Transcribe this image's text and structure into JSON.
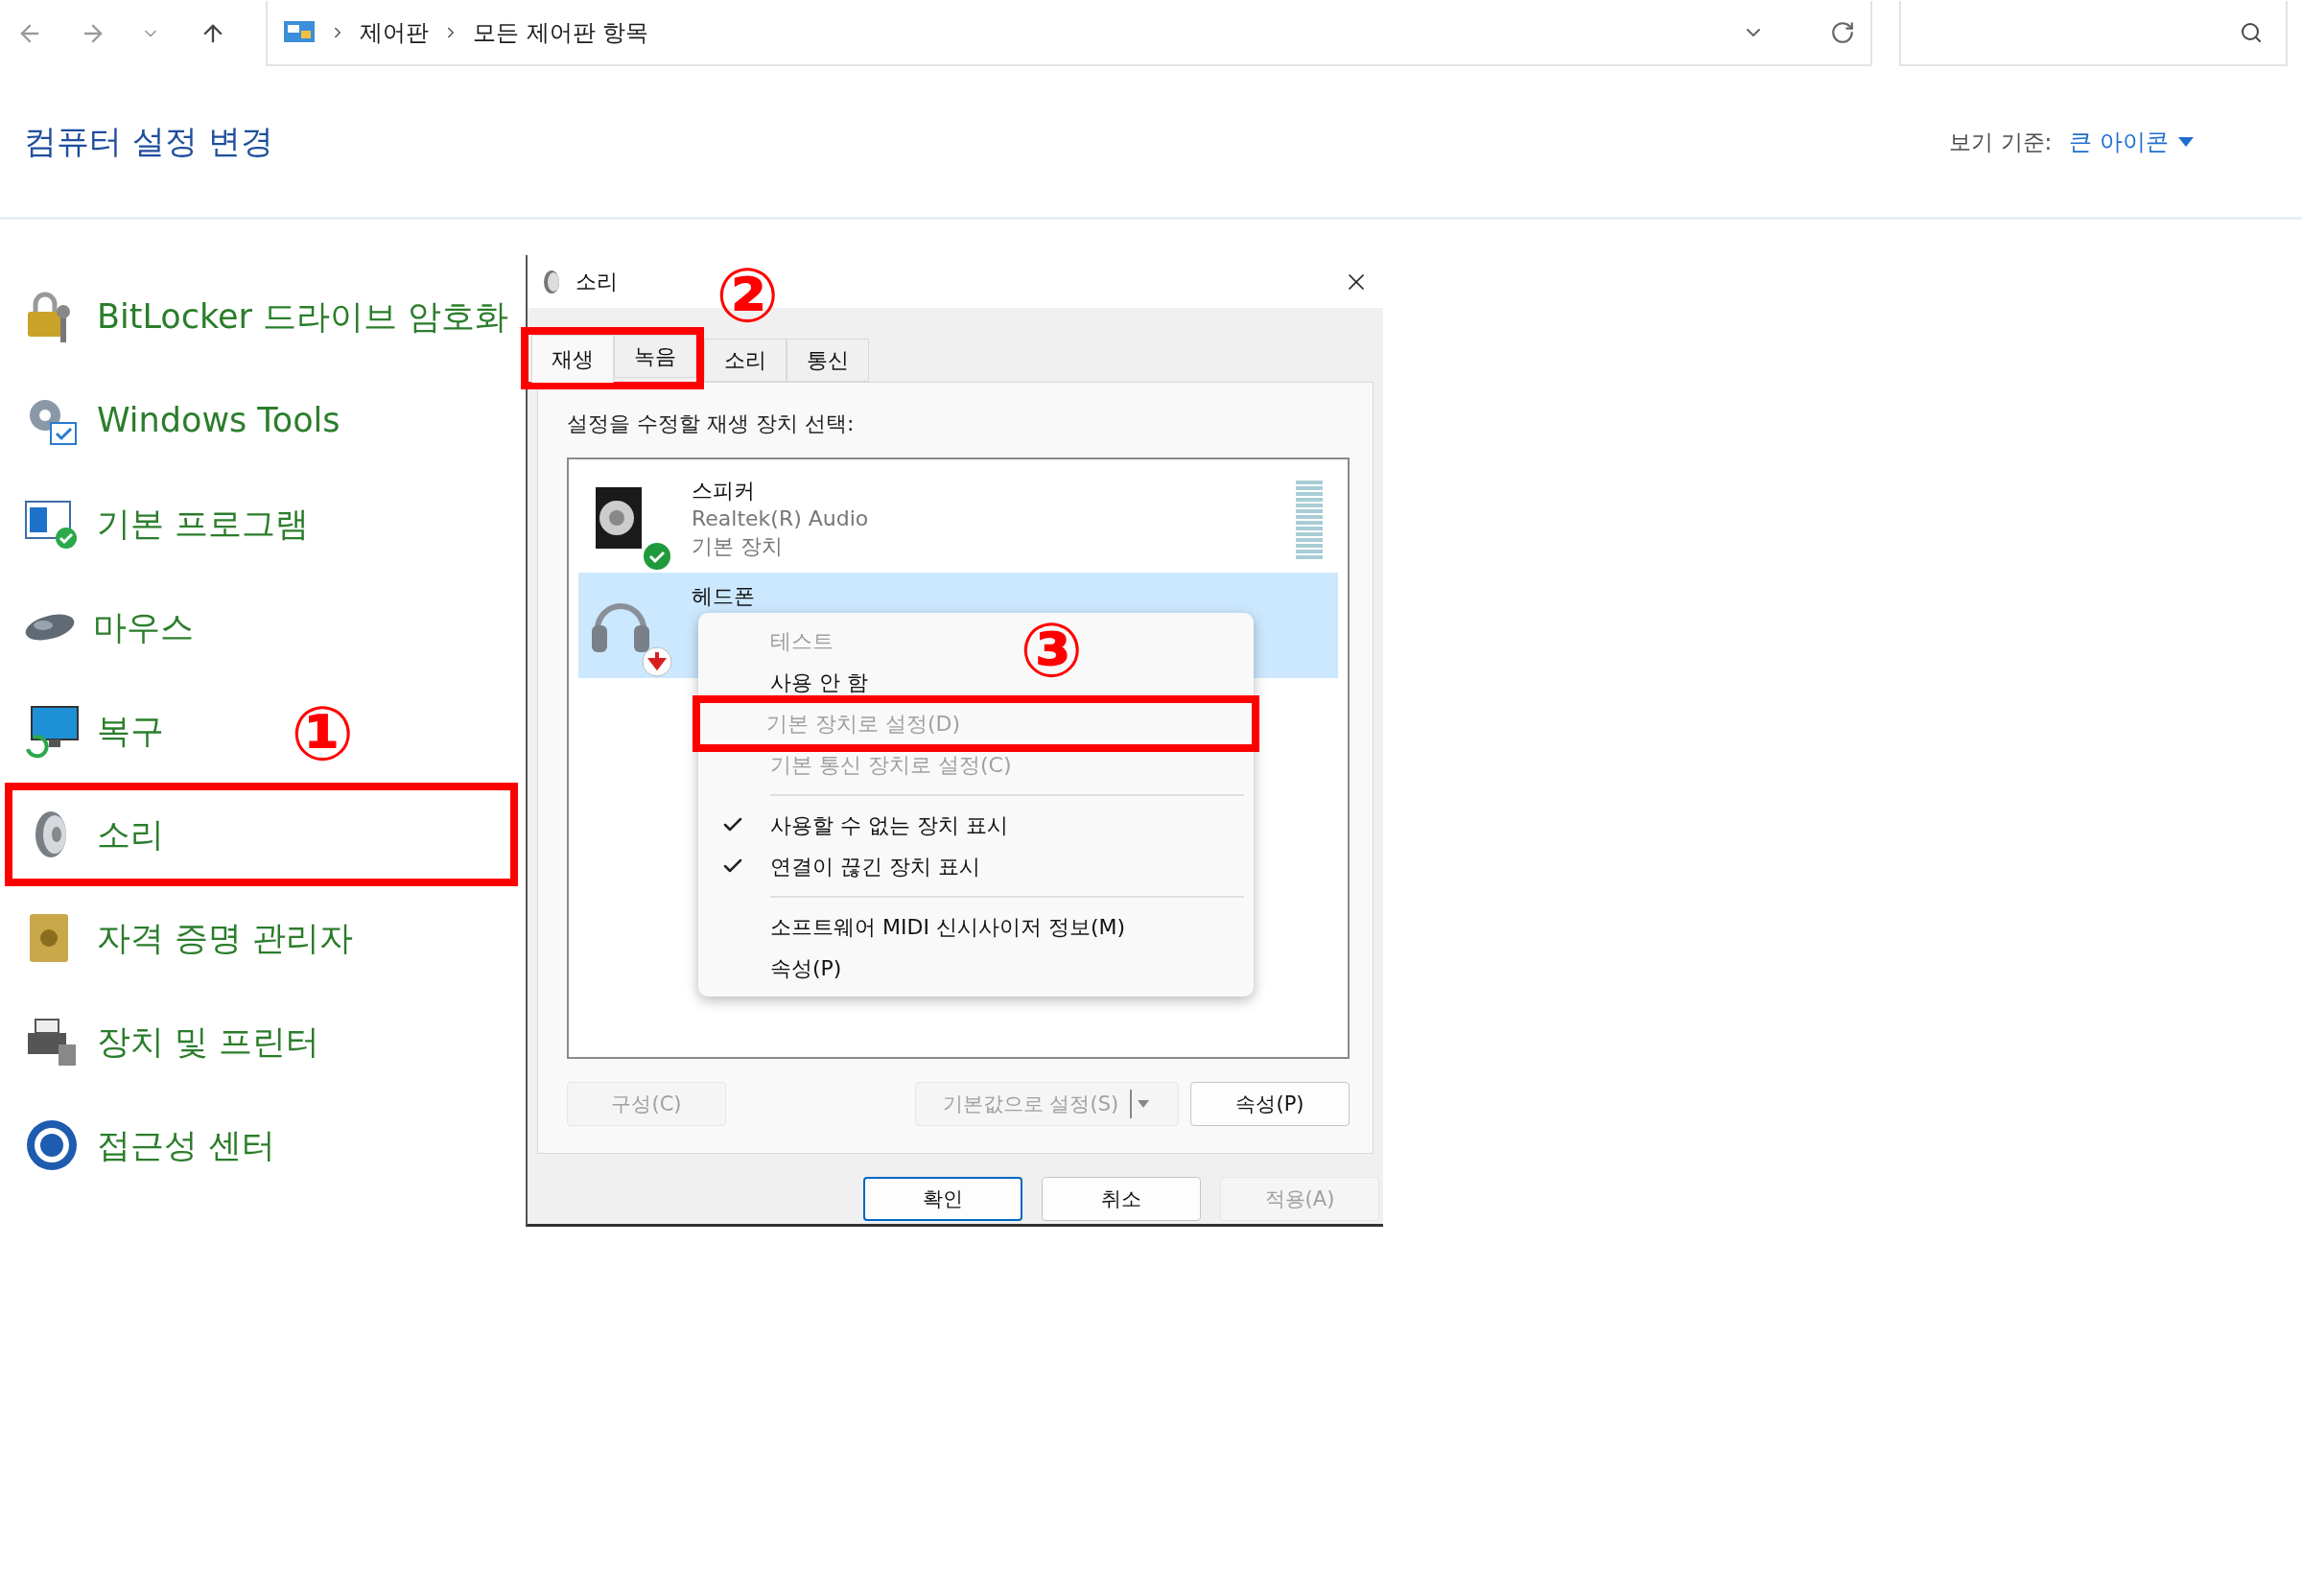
{
  "address_bar": {
    "path": [
      "제어판",
      "모든 제어판 항목"
    ]
  },
  "header": {
    "title": "컴퓨터 설정 변경",
    "view_by_label": "보기 기준:",
    "view_by_value": "큰 아이콘"
  },
  "items": [
    {
      "label": "BitLocker 드라이브 암호화",
      "highlighted": false
    },
    {
      "label": "Windows Tools",
      "highlighted": false
    },
    {
      "label": "기본 프로그램",
      "highlighted": false
    },
    {
      "label": "마우스",
      "highlighted": false
    },
    {
      "label": "복구",
      "highlighted": false,
      "annotation": "①"
    },
    {
      "label": "소리",
      "highlighted": true
    },
    {
      "label": "자격 증명 관리자",
      "highlighted": false
    },
    {
      "label": "장치 및 프린터",
      "highlighted": false
    },
    {
      "label": "접근성 센터",
      "highlighted": false
    }
  ],
  "dialog": {
    "title": "소리",
    "tabs": [
      {
        "label": "재생",
        "selected": true,
        "highlighted": true
      },
      {
        "label": "녹음",
        "selected": false,
        "highlighted": true
      },
      {
        "label": "소리",
        "selected": false,
        "highlighted": false
      },
      {
        "label": "통신",
        "selected": false,
        "highlighted": false
      }
    ],
    "tabs_annotation": "②",
    "prompt": "설정을 수정할 재생 장치 선택:",
    "devices": [
      {
        "kind": "speaker",
        "name": "스피커",
        "driver": "Realtek(R) Audio",
        "status": "기본 장치",
        "default_device": true,
        "unplugged": false,
        "selected": false
      },
      {
        "kind": "headphones",
        "name": "헤드폰",
        "default_device": false,
        "unplugged": true,
        "selected": true
      }
    ],
    "menu_annotation": "③",
    "context_menu": [
      {
        "kind": "item",
        "label": "테스트",
        "disabled": true,
        "checked": false,
        "highlighted": false
      },
      {
        "kind": "item",
        "label": "사용 안 함",
        "disabled": false,
        "checked": false,
        "highlighted": false
      },
      {
        "kind": "item",
        "label": "기본 장치로 설정(D)",
        "disabled": true,
        "checked": false,
        "highlighted": true
      },
      {
        "kind": "item",
        "label": "기본 통신 장치로 설정(C)",
        "disabled": true,
        "checked": false,
        "highlighted": false
      },
      {
        "kind": "separator"
      },
      {
        "kind": "item",
        "label": "사용할 수 없는 장치 표시",
        "disabled": false,
        "checked": true,
        "highlighted": false
      },
      {
        "kind": "item",
        "label": "연결이 끊긴 장치 표시",
        "disabled": false,
        "checked": true,
        "highlighted": false
      },
      {
        "kind": "separator"
      },
      {
        "kind": "item",
        "label": "소프트웨어 MIDI 신시사이저 정보(M)",
        "disabled": false,
        "checked": false,
        "highlighted": false
      },
      {
        "kind": "item",
        "label": "속성(P)",
        "disabled": false,
        "checked": false,
        "highlighted": false
      }
    ],
    "panel_buttons": [
      {
        "kind": "plain",
        "label": "구성(C)",
        "disabled": true
      },
      {
        "kind": "split",
        "label": "기본값으로 설정(S)",
        "disabled": true
      },
      {
        "kind": "plain",
        "label": "속성(P)",
        "disabled": false
      }
    ],
    "buttons": [
      {
        "label": "확인",
        "default": true,
        "disabled": false
      },
      {
        "label": "취소",
        "default": false,
        "disabled": false
      },
      {
        "label": "적용(A)",
        "default": false,
        "disabled": true
      }
    ]
  }
}
